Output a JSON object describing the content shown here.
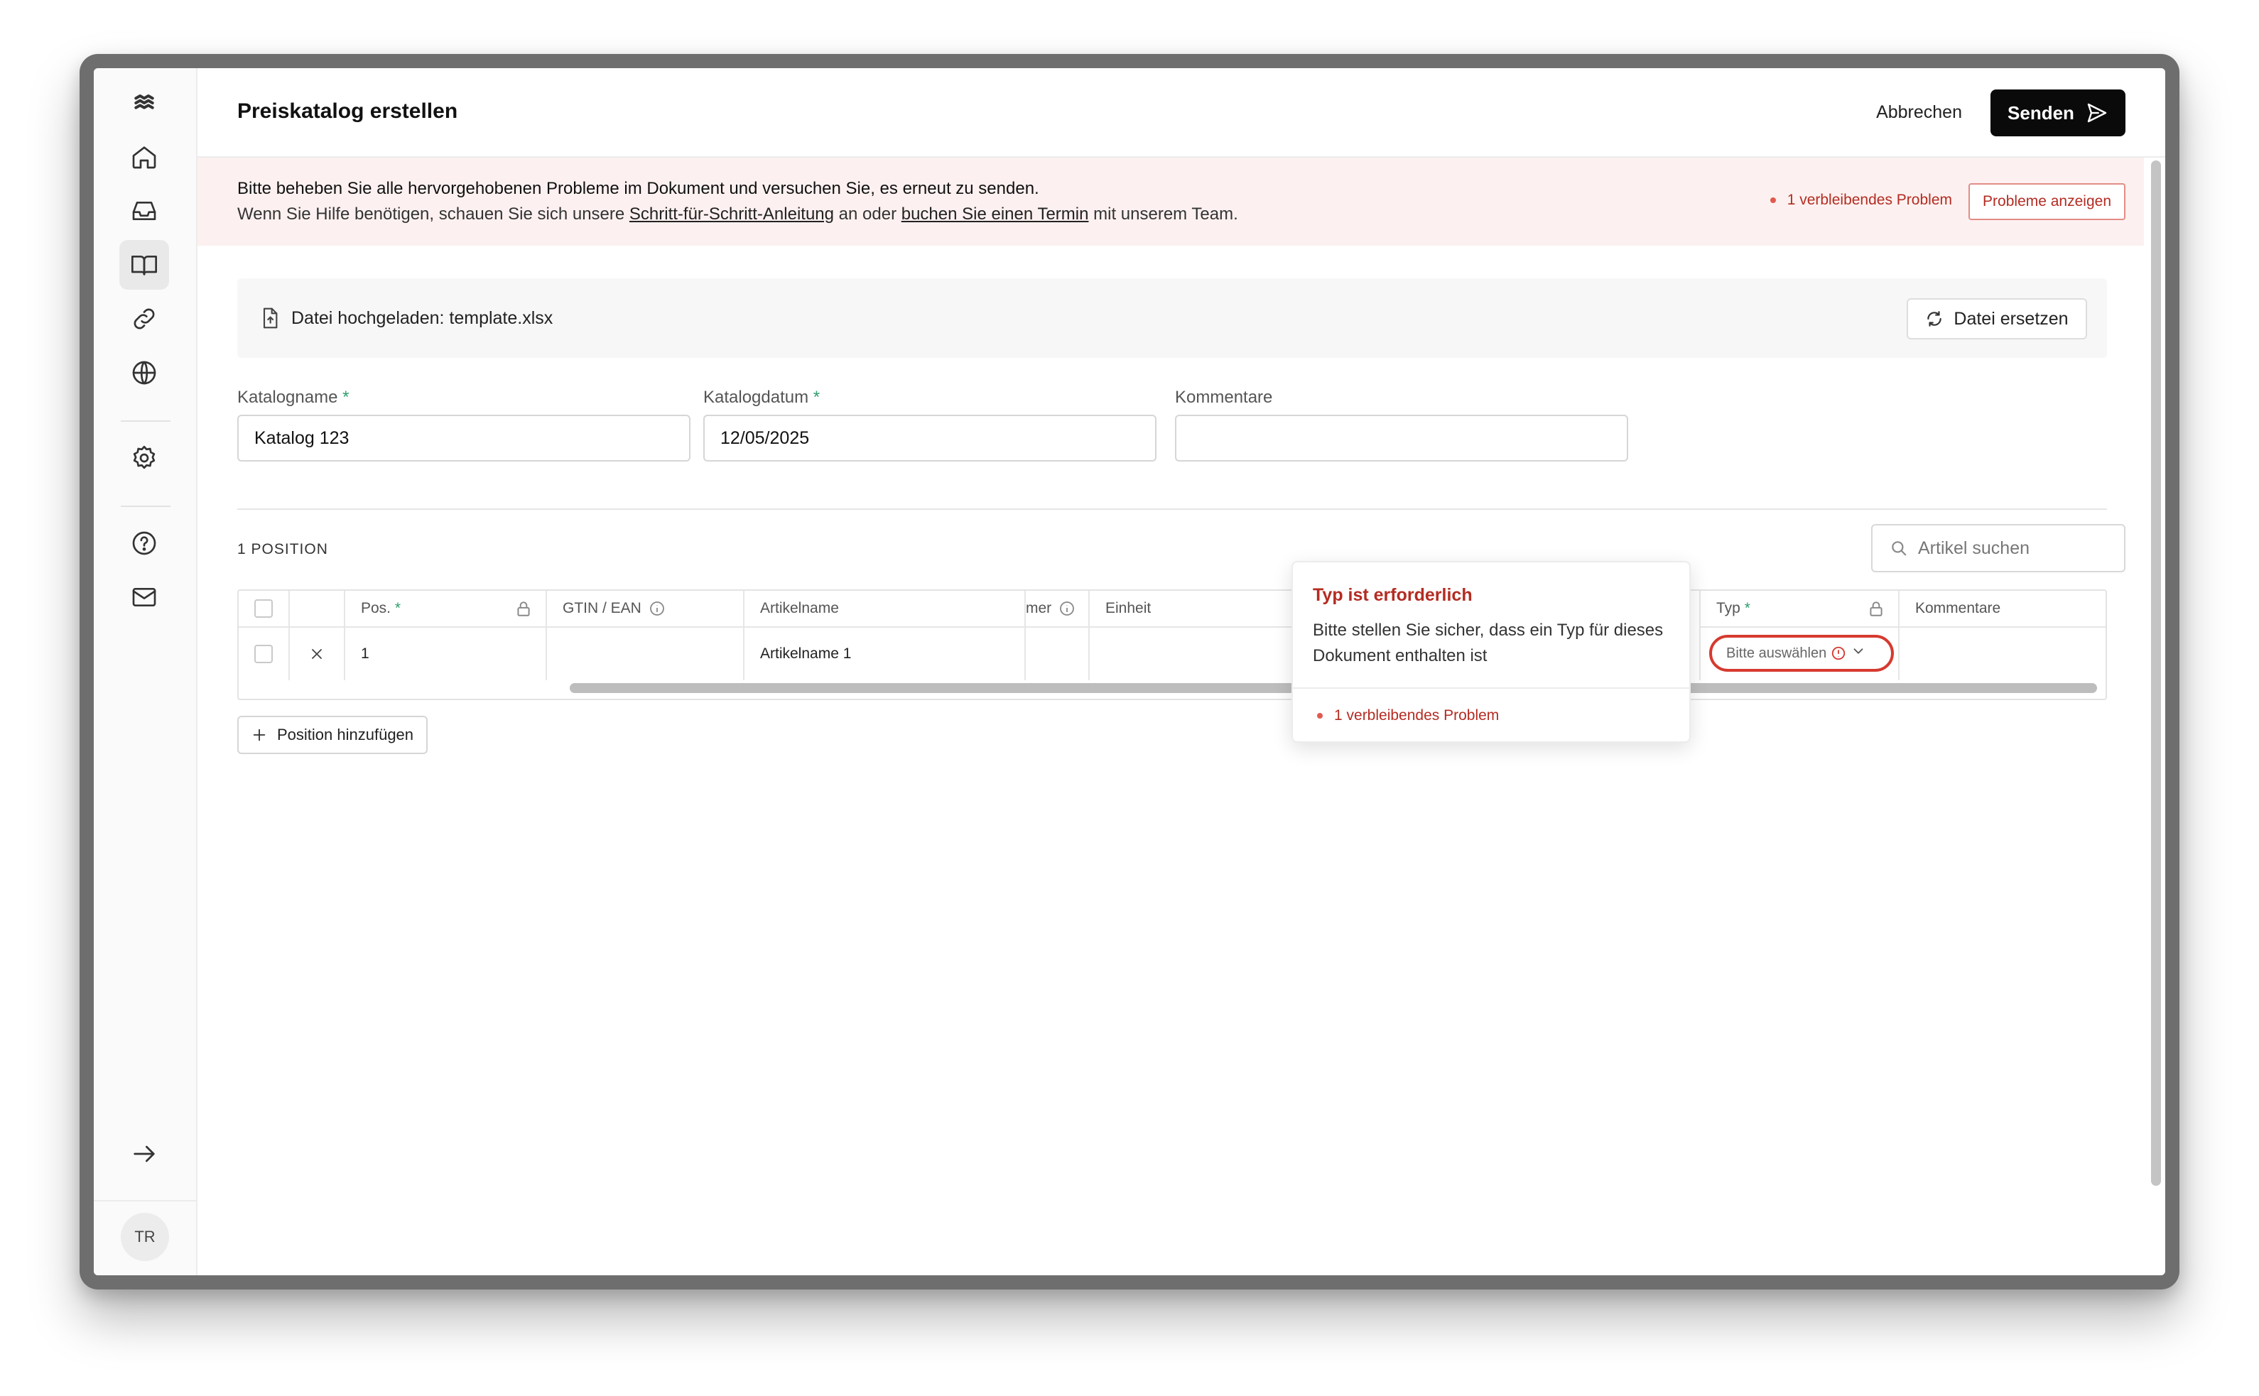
{
  "header": {
    "title": "Preiskatalog erstellen",
    "cancel_label": "Abbrechen",
    "send_label": "Senden"
  },
  "alert": {
    "line1": "Bitte beheben Sie alle hervorgehobenen Probleme im Dokument und versuchen Sie, es erneut zu senden.",
    "line2_prefix": "Wenn Sie Hilfe benötigen, schauen Sie sich unsere ",
    "link_guide": "Schritt-für-Schritt-Anleitung",
    "line2_mid": " an oder ",
    "link_appointment": "buchen Sie einen Termin",
    "line2_suffix": " mit unserem Team.",
    "problem_count": "1 verbleibendes Problem",
    "show_problems_label": "Probleme anzeigen"
  },
  "upload": {
    "text": "Datei hochgeladen: template.xlsx",
    "replace_label": "Datei ersetzen"
  },
  "form": {
    "catalog_name_label": "Katalogname",
    "catalog_name_value": "Katalog 123",
    "catalog_date_label": "Katalogdatum",
    "catalog_date_value": "12/05/2025",
    "comments_label": "Kommentare",
    "comments_value": "",
    "required_marker": "*"
  },
  "positions": {
    "count_label": "1 POSITION",
    "search_placeholder": "Artikel suchen",
    "add_label": "Position hinzufügen"
  },
  "table": {
    "headers": {
      "pos": "Pos.",
      "gtin": "GTIN / EAN",
      "article_name": "Artikelname",
      "article_number_partial": "mer",
      "unit": "Einheit",
      "type": "Typ",
      "comments": "Kommentare"
    },
    "rows": [
      {
        "pos": "1",
        "gtin": "",
        "article_name": "Artikelname 1",
        "type_placeholder": "Bitte auswählen"
      }
    ]
  },
  "tooltip": {
    "title": "Typ ist erforderlich",
    "body": "Bitte stellen Sie sicher, dass ein Typ für dieses Dokument enthalten ist",
    "footer": "1 verbleibendes Problem"
  },
  "user": {
    "initials": "TR"
  },
  "colors": {
    "error": "#b32c22",
    "error_border": "#d63a30",
    "alert_bg": "#fcf1f0",
    "primary": "#0a0a0a"
  }
}
